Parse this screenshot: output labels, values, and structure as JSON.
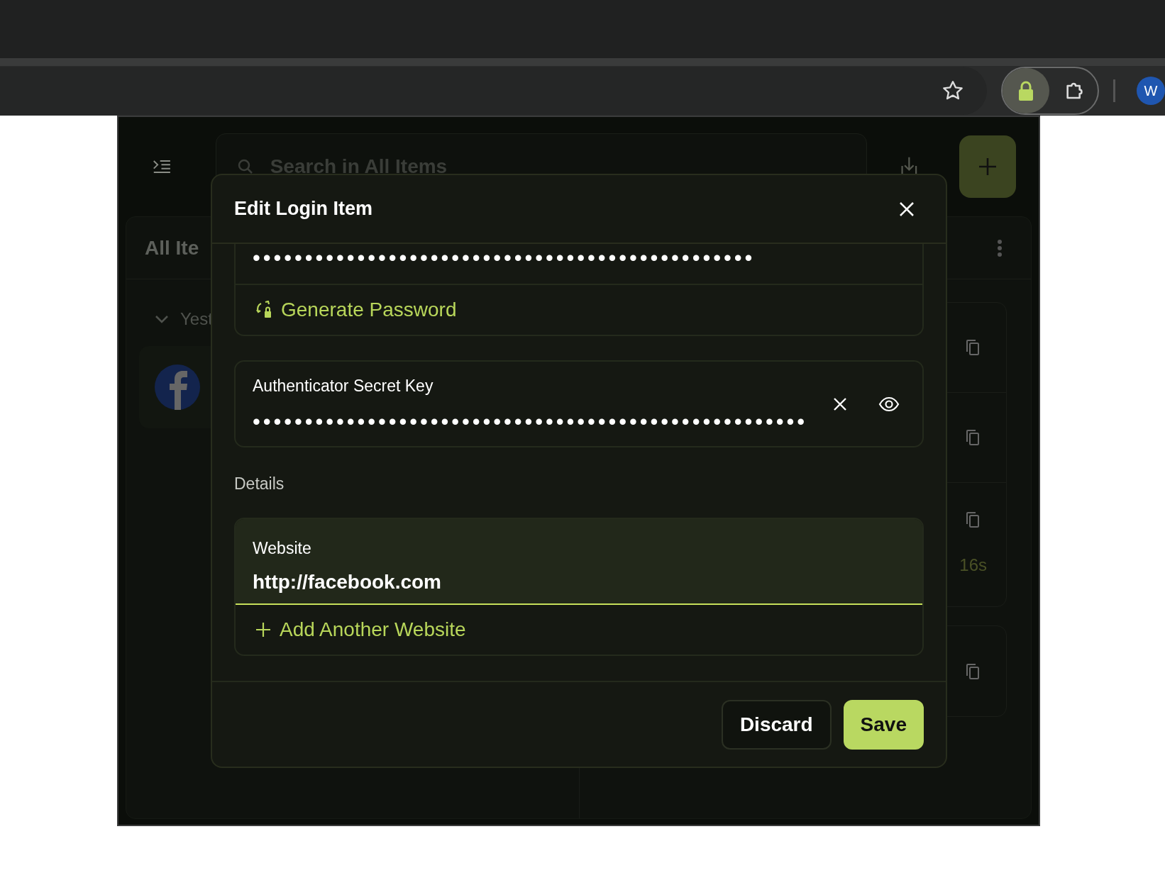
{
  "browser": {
    "avatar": "W"
  },
  "popup": {
    "search": {
      "placeholder": "Search in All Items"
    },
    "list": {
      "title": "All Ite",
      "group": "Yest",
      "group_expanded": true
    },
    "detail": {
      "timer": "16s"
    }
  },
  "modal": {
    "title": "Edit Login Item",
    "password": {
      "value": "••••••••••••••••••••••••••••••••••••••••••••••••",
      "action": "Generate Password"
    },
    "secret": {
      "label": "Authenticator Secret Key",
      "value": "•••••••••••••••••••••••••••••••••••••••••••••••••••••"
    },
    "section": "Details",
    "website": {
      "label": "Website",
      "value": "http://facebook.com",
      "focused": true,
      "action": "Add Another Website"
    },
    "buttons": [
      {
        "label": "Discard",
        "kind": "secondary"
      },
      {
        "label": "Save",
        "kind": "primary"
      }
    ]
  }
}
